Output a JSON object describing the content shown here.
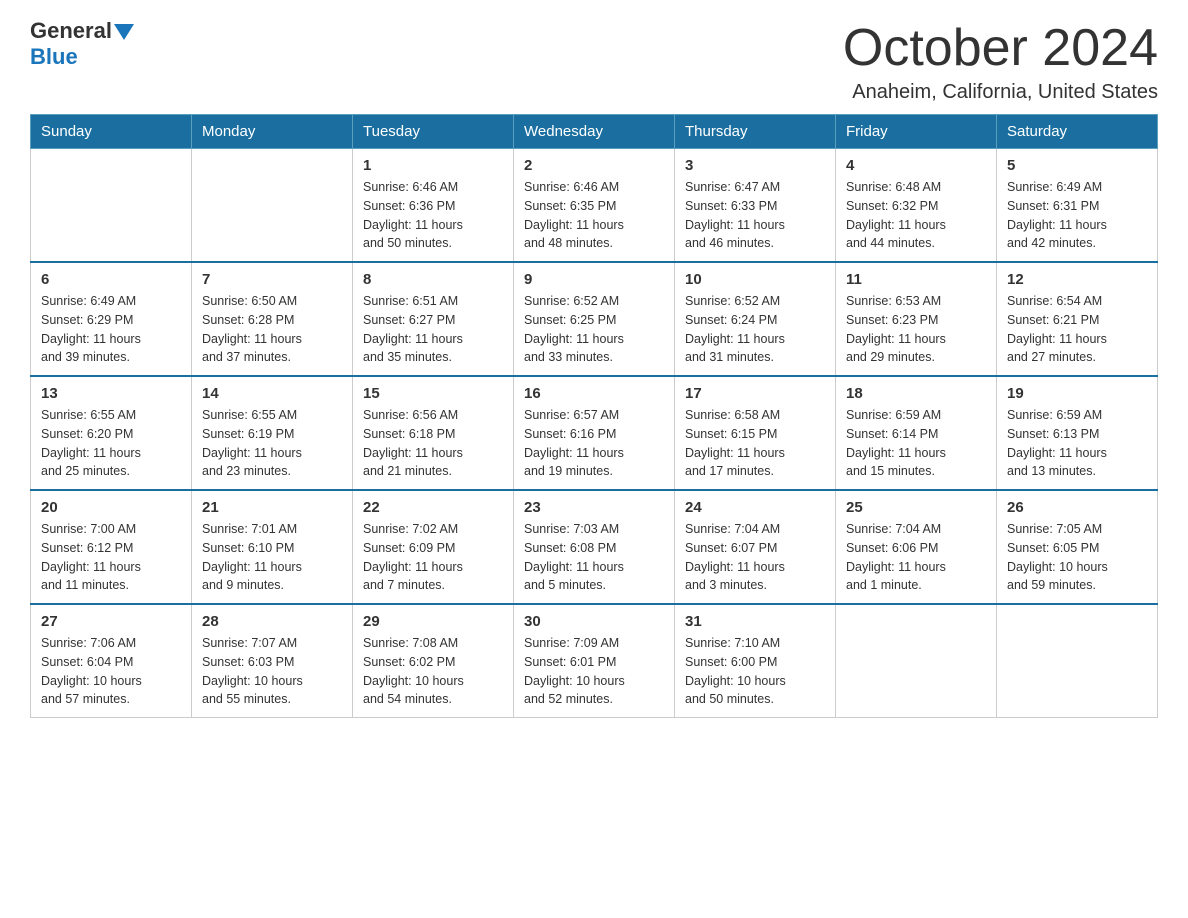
{
  "header": {
    "logo_general": "General",
    "logo_blue": "Blue",
    "title": "October 2024",
    "subtitle": "Anaheim, California, United States"
  },
  "columns": [
    "Sunday",
    "Monday",
    "Tuesday",
    "Wednesday",
    "Thursday",
    "Friday",
    "Saturday"
  ],
  "weeks": [
    [
      {
        "day": "",
        "info": ""
      },
      {
        "day": "",
        "info": ""
      },
      {
        "day": "1",
        "info": "Sunrise: 6:46 AM\nSunset: 6:36 PM\nDaylight: 11 hours\nand 50 minutes."
      },
      {
        "day": "2",
        "info": "Sunrise: 6:46 AM\nSunset: 6:35 PM\nDaylight: 11 hours\nand 48 minutes."
      },
      {
        "day": "3",
        "info": "Sunrise: 6:47 AM\nSunset: 6:33 PM\nDaylight: 11 hours\nand 46 minutes."
      },
      {
        "day": "4",
        "info": "Sunrise: 6:48 AM\nSunset: 6:32 PM\nDaylight: 11 hours\nand 44 minutes."
      },
      {
        "day": "5",
        "info": "Sunrise: 6:49 AM\nSunset: 6:31 PM\nDaylight: 11 hours\nand 42 minutes."
      }
    ],
    [
      {
        "day": "6",
        "info": "Sunrise: 6:49 AM\nSunset: 6:29 PM\nDaylight: 11 hours\nand 39 minutes."
      },
      {
        "day": "7",
        "info": "Sunrise: 6:50 AM\nSunset: 6:28 PM\nDaylight: 11 hours\nand 37 minutes."
      },
      {
        "day": "8",
        "info": "Sunrise: 6:51 AM\nSunset: 6:27 PM\nDaylight: 11 hours\nand 35 minutes."
      },
      {
        "day": "9",
        "info": "Sunrise: 6:52 AM\nSunset: 6:25 PM\nDaylight: 11 hours\nand 33 minutes."
      },
      {
        "day": "10",
        "info": "Sunrise: 6:52 AM\nSunset: 6:24 PM\nDaylight: 11 hours\nand 31 minutes."
      },
      {
        "day": "11",
        "info": "Sunrise: 6:53 AM\nSunset: 6:23 PM\nDaylight: 11 hours\nand 29 minutes."
      },
      {
        "day": "12",
        "info": "Sunrise: 6:54 AM\nSunset: 6:21 PM\nDaylight: 11 hours\nand 27 minutes."
      }
    ],
    [
      {
        "day": "13",
        "info": "Sunrise: 6:55 AM\nSunset: 6:20 PM\nDaylight: 11 hours\nand 25 minutes."
      },
      {
        "day": "14",
        "info": "Sunrise: 6:55 AM\nSunset: 6:19 PM\nDaylight: 11 hours\nand 23 minutes."
      },
      {
        "day": "15",
        "info": "Sunrise: 6:56 AM\nSunset: 6:18 PM\nDaylight: 11 hours\nand 21 minutes."
      },
      {
        "day": "16",
        "info": "Sunrise: 6:57 AM\nSunset: 6:16 PM\nDaylight: 11 hours\nand 19 minutes."
      },
      {
        "day": "17",
        "info": "Sunrise: 6:58 AM\nSunset: 6:15 PM\nDaylight: 11 hours\nand 17 minutes."
      },
      {
        "day": "18",
        "info": "Sunrise: 6:59 AM\nSunset: 6:14 PM\nDaylight: 11 hours\nand 15 minutes."
      },
      {
        "day": "19",
        "info": "Sunrise: 6:59 AM\nSunset: 6:13 PM\nDaylight: 11 hours\nand 13 minutes."
      }
    ],
    [
      {
        "day": "20",
        "info": "Sunrise: 7:00 AM\nSunset: 6:12 PM\nDaylight: 11 hours\nand 11 minutes."
      },
      {
        "day": "21",
        "info": "Sunrise: 7:01 AM\nSunset: 6:10 PM\nDaylight: 11 hours\nand 9 minutes."
      },
      {
        "day": "22",
        "info": "Sunrise: 7:02 AM\nSunset: 6:09 PM\nDaylight: 11 hours\nand 7 minutes."
      },
      {
        "day": "23",
        "info": "Sunrise: 7:03 AM\nSunset: 6:08 PM\nDaylight: 11 hours\nand 5 minutes."
      },
      {
        "day": "24",
        "info": "Sunrise: 7:04 AM\nSunset: 6:07 PM\nDaylight: 11 hours\nand 3 minutes."
      },
      {
        "day": "25",
        "info": "Sunrise: 7:04 AM\nSunset: 6:06 PM\nDaylight: 11 hours\nand 1 minute."
      },
      {
        "day": "26",
        "info": "Sunrise: 7:05 AM\nSunset: 6:05 PM\nDaylight: 10 hours\nand 59 minutes."
      }
    ],
    [
      {
        "day": "27",
        "info": "Sunrise: 7:06 AM\nSunset: 6:04 PM\nDaylight: 10 hours\nand 57 minutes."
      },
      {
        "day": "28",
        "info": "Sunrise: 7:07 AM\nSunset: 6:03 PM\nDaylight: 10 hours\nand 55 minutes."
      },
      {
        "day": "29",
        "info": "Sunrise: 7:08 AM\nSunset: 6:02 PM\nDaylight: 10 hours\nand 54 minutes."
      },
      {
        "day": "30",
        "info": "Sunrise: 7:09 AM\nSunset: 6:01 PM\nDaylight: 10 hours\nand 52 minutes."
      },
      {
        "day": "31",
        "info": "Sunrise: 7:10 AM\nSunset: 6:00 PM\nDaylight: 10 hours\nand 50 minutes."
      },
      {
        "day": "",
        "info": ""
      },
      {
        "day": "",
        "info": ""
      }
    ]
  ]
}
